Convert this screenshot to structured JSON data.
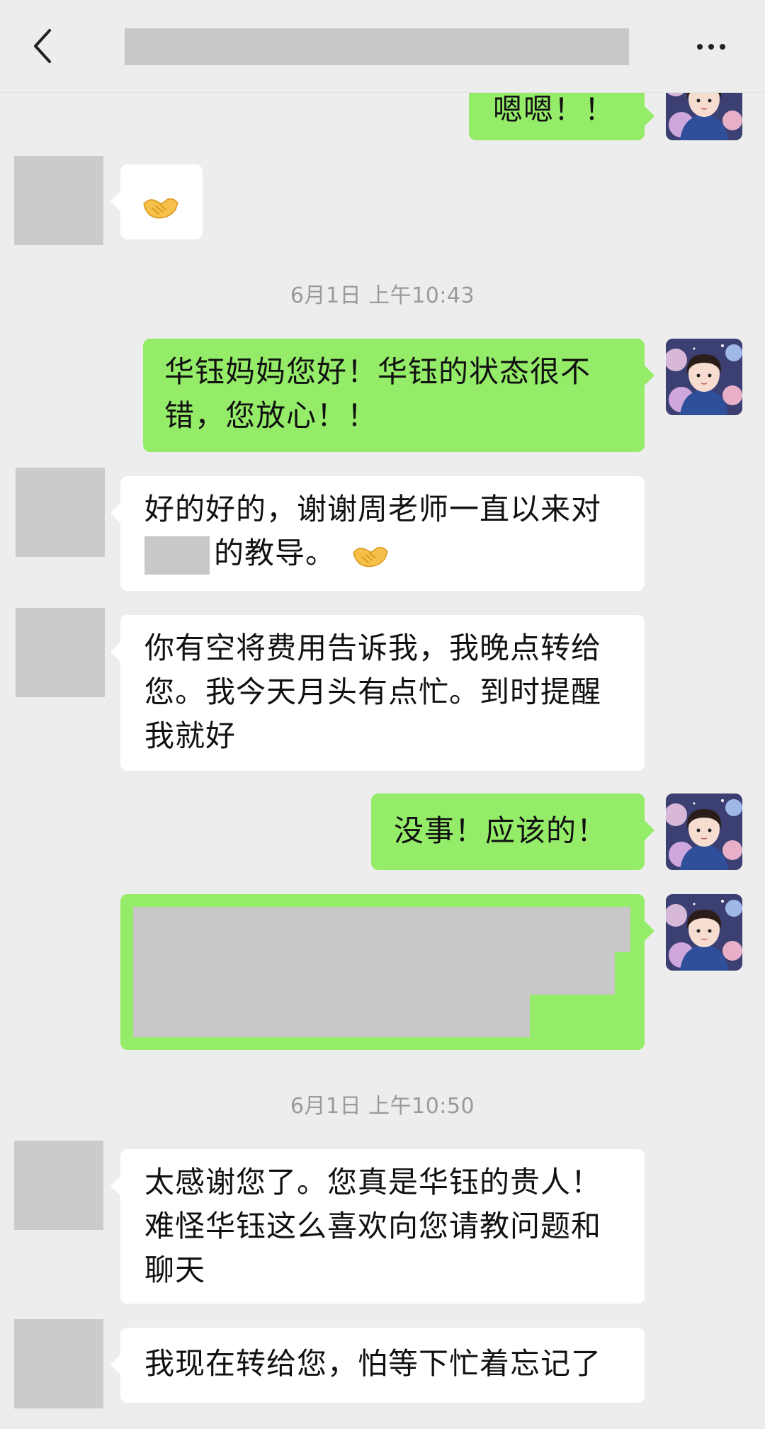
{
  "chat": {
    "messages": [
      {
        "text": "嗯嗯！！"
      },
      {
        "text": ""
      },
      {
        "text": "华钰妈妈您好！华钰的状态很不错，您放心！！"
      },
      {
        "text_line1": "好的好的，谢谢周老师一直以来对",
        "text_line2": "的教导。"
      },
      {
        "text": "你有空将费用告诉我，我晚点转给您。我今天月头有点忙。到时提醒我就好"
      },
      {
        "text": "没事！应该的！"
      },
      {
        "text": ""
      },
      {
        "text": "太感谢您了。您真是华钰的贵人！难怪华钰这么喜欢向您请教问题和聊天"
      },
      {
        "text": "我现在转给您，怕等下忙着忘记了"
      }
    ],
    "timestamps": [
      "6月1日 上午10:43",
      "6月1日 上午10:50"
    ]
  },
  "icons": {
    "back": "chevron-left-icon",
    "more": "more-horizontal-icon",
    "handshake": "handshake-emoji"
  },
  "colors": {
    "background": "#ededed",
    "sent_bubble": "#95ec69",
    "received_bubble": "#ffffff",
    "redaction": "#c8c8c8"
  }
}
